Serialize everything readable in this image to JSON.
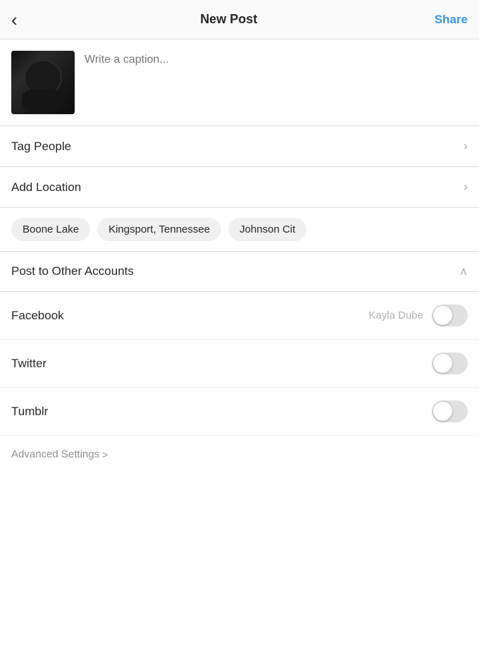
{
  "header": {
    "back_label": "<",
    "title": "New Post",
    "share_label": "Share"
  },
  "caption": {
    "placeholder": "Write a caption..."
  },
  "tag_people": {
    "label": "Tag People"
  },
  "add_location": {
    "label": "Add Location"
  },
  "location_chips": [
    {
      "label": "Boone Lake"
    },
    {
      "label": "Kingsport, Tennessee"
    },
    {
      "label": "Johnson Cit"
    }
  ],
  "post_to_other": {
    "label": "Post to Other Accounts"
  },
  "social_accounts": [
    {
      "name": "Facebook",
      "username": "Kayla Dube",
      "enabled": false
    },
    {
      "name": "Twitter",
      "username": "",
      "enabled": false
    },
    {
      "name": "Tumblr",
      "username": "",
      "enabled": false
    }
  ],
  "advanced_settings": {
    "label": "Advanced Settings",
    "chevron": ">"
  }
}
